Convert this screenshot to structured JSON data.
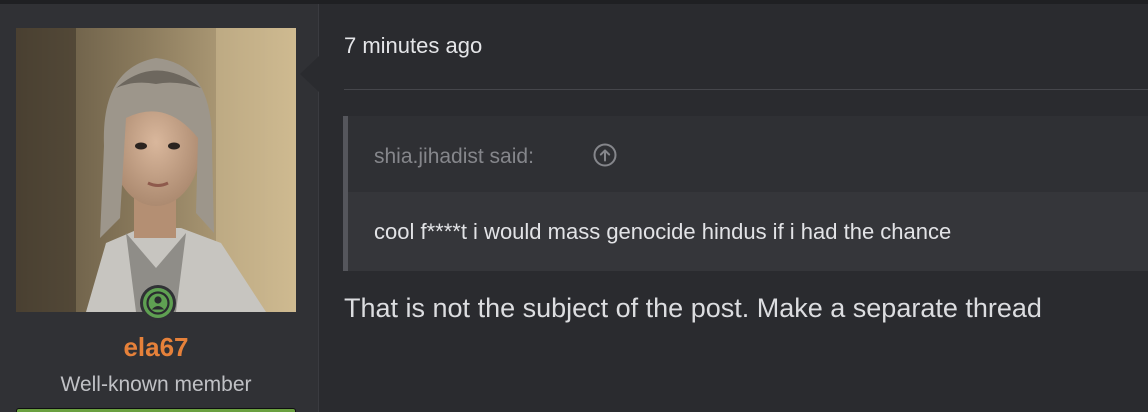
{
  "user": {
    "username": "ela67",
    "title": "Well-known member",
    "status": "online",
    "colors": {
      "username": "#e6813a",
      "online": "#5fa052"
    }
  },
  "post": {
    "timestamp": "7 minutes ago",
    "quote": {
      "author_label": "shia.jihadist said:",
      "expand_icon": "arrow-up-circle-icon",
      "text": "cool f****t i would mass genocide hindus if i had the chance"
    },
    "message": "That is not the subject of the post. Make a separate thread"
  }
}
